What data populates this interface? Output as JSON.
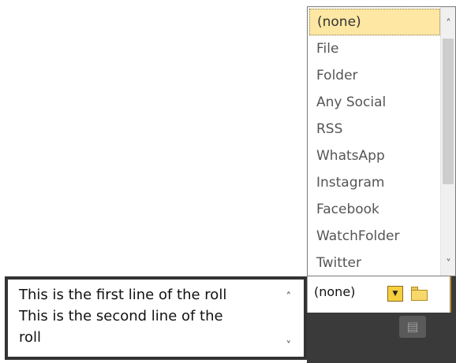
{
  "dropdown": {
    "items": [
      {
        "label": "(none)",
        "selected": true
      },
      {
        "label": "File"
      },
      {
        "label": "Folder"
      },
      {
        "label": "Any Social"
      },
      {
        "label": "RSS"
      },
      {
        "label": "WhatsApp"
      },
      {
        "label": "Instagram"
      },
      {
        "label": "Facebook"
      },
      {
        "label": "WatchFolder"
      },
      {
        "label": "Twitter"
      }
    ],
    "scroll_up_icon": "chevron-up-icon",
    "scroll_down_icon": "chevron-down-icon"
  },
  "combo": {
    "value": "(none)",
    "dropdown_icon": "dropdown-arrow-icon",
    "folder_icon": "folder-icon"
  },
  "textbox": {
    "lines": [
      "This is the first line of the  roll",
      "This is the second line of the",
      "roll"
    ]
  },
  "panel": {
    "icon": "image-icon"
  },
  "colors": {
    "selected_bg": "#fde7a3",
    "panel_bg": "#3a3a3a",
    "button_yellow": "#f6cf3e"
  }
}
